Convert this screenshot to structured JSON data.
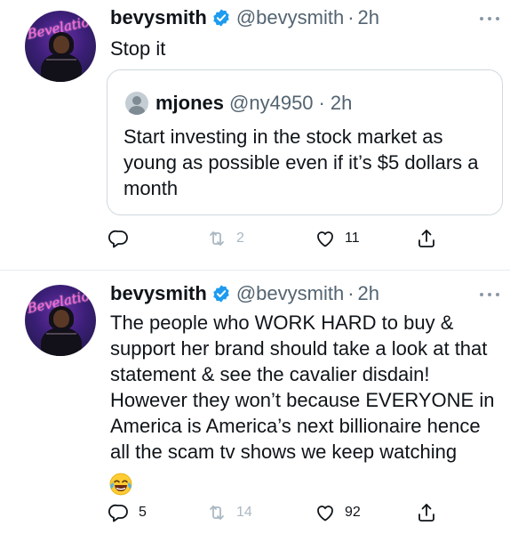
{
  "tweets": [
    {
      "author_name": "bevysmith",
      "author_handle": "@bevysmith",
      "separator": "·",
      "time": "2h",
      "avatar_text": "Bevelations",
      "text": "Stop it",
      "quote": {
        "author_name": "mjones",
        "author_handle": "@ny4950",
        "separator": "·",
        "time": "2h",
        "text": "Start investing in the stock market as young as possible even if it’s $5 dollars a month"
      },
      "actions": {
        "replies": "",
        "retweets": "2",
        "likes": "11"
      }
    },
    {
      "author_name": "bevysmith",
      "author_handle": "@bevysmith",
      "separator": "·",
      "time": "2h",
      "avatar_text": "Bevelations",
      "text": "The people who WORK HARD to buy & support her brand should take a look at that statement & see the cavalier disdain! However they won’t because EVERYONE in America is America’s next billionaire hence all the scam tv shows we keep watching",
      "emoji": "face-with-tears-of-joy",
      "actions": {
        "replies": "5",
        "retweets": "14",
        "likes": "92"
      }
    }
  ],
  "colors": {
    "text": "#0f1419",
    "secondary": "#536471",
    "verified": "#1d9bf0",
    "retweet_disabled": "#aab8c2",
    "border": "#cfd9de"
  },
  "icons": [
    "verified-badge-icon",
    "more-icon",
    "reply-icon",
    "retweet-icon",
    "like-icon",
    "share-icon"
  ]
}
